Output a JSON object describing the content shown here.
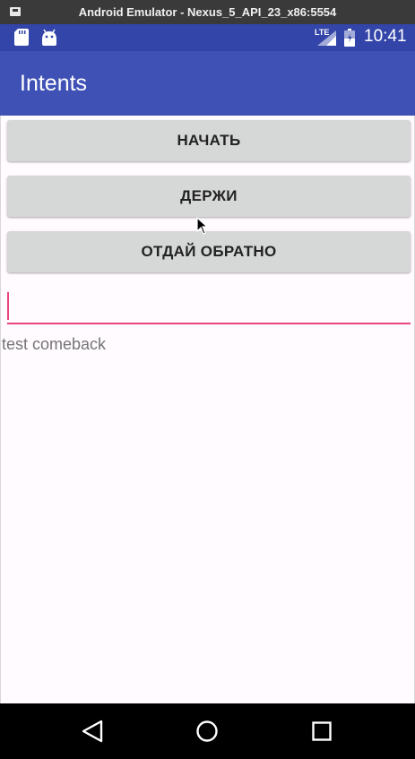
{
  "emulator": {
    "title": "Android Emulator - Nexus_5_API_23_x86:5554"
  },
  "status_bar": {
    "network_label": "LTE",
    "time": "10:41",
    "icons": [
      "sd-card-icon",
      "android-debug-icon",
      "signal-icon",
      "battery-icon"
    ]
  },
  "app_bar": {
    "title": "Intents"
  },
  "main": {
    "buttons": [
      {
        "label": "НАЧАТЬ"
      },
      {
        "label": "ДЕРЖИ"
      },
      {
        "label": "ОТДАЙ ОБРАТНО"
      }
    ],
    "input": {
      "value": ""
    },
    "result_text": "test comeback"
  },
  "nav_bar": {
    "icons": [
      "back-icon",
      "home-icon",
      "recents-icon"
    ]
  },
  "colors": {
    "status_bar": "#3345a8",
    "app_bar": "#3f51b5",
    "accent": "#e8457b",
    "button": "#d6d7d7"
  }
}
